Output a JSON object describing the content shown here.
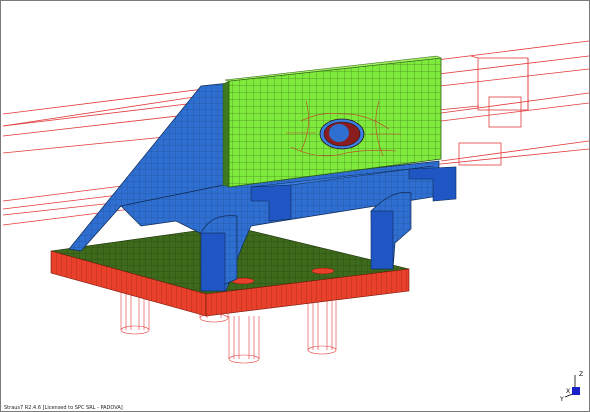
{
  "status_bar": {
    "text": "Straus7 R2.4.6 [Licensed to SPC SRL - PADOVA]"
  },
  "axis_triad": {
    "x_label": "X",
    "y_label": "Y",
    "z_label": "Z"
  },
  "colors": {
    "background": "#ffffff",
    "wireframe": "#e23a3a",
    "plate": "#7dea3c",
    "bracket_body": "#2e6fd1",
    "base_plate": "#e8402a",
    "mesh_line": "#1f3a12"
  }
}
